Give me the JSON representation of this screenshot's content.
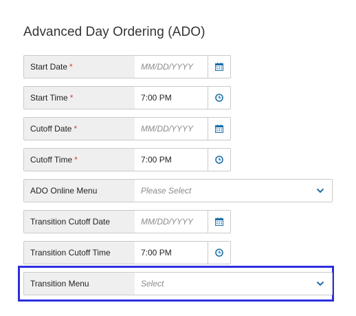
{
  "title": "Advanced Day Ordering (ADO)",
  "required_marker": "*",
  "fields": {
    "start_date": {
      "label": "Start Date",
      "placeholder": "MM/DD/YYYY"
    },
    "start_time": {
      "label": "Start Time",
      "value": "7:00 PM"
    },
    "cutoff_date": {
      "label": "Cutoff Date",
      "placeholder": "MM/DD/YYYY"
    },
    "cutoff_time": {
      "label": "Cutoff Time",
      "value": "7:00 PM"
    },
    "ado_online_menu": {
      "label": "ADO Online Menu",
      "placeholder": "Please Select"
    },
    "transition_cutoff_date": {
      "label": "Transition Cutoff Date",
      "placeholder": "MM/DD/YYYY"
    },
    "transition_cutoff_time": {
      "label": "Transition Cutoff Time",
      "value": "7:00 PM"
    },
    "transition_menu": {
      "label": "Transition Menu",
      "placeholder": "Select"
    }
  },
  "icons": {
    "date_picker": "calendar-icon",
    "time_picker": "clock-icon",
    "dropdown": "chevron-down-icon"
  },
  "colors": {
    "accent": "#1b6fa8",
    "required": "#d23b3b",
    "highlight": "#2b2ee0"
  }
}
